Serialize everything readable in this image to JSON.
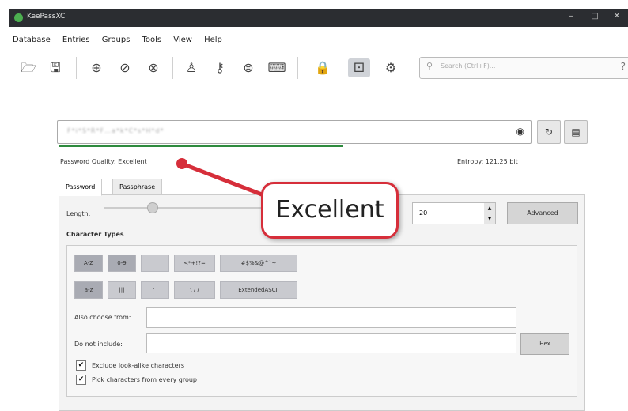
{
  "window": {
    "title": "KeePassXC",
    "controls": {
      "minimize": "–",
      "maximize": "□",
      "close": "✕"
    }
  },
  "menu": [
    "Database",
    "Entries",
    "Groups",
    "Tools",
    "View",
    "Help"
  ],
  "toolbar": {
    "icons": [
      "open-database-icon",
      "save-database-icon",
      "add-entry-icon",
      "edit-entry-icon",
      "delete-entry-icon",
      "copy-username-icon",
      "copy-password-icon",
      "copy-url-icon",
      "autotype-icon",
      "lock-database-icon",
      "password-generator-icon",
      "settings-icon"
    ],
    "search_placeholder": "Search (Ctrl+F)...",
    "search_help": "?"
  },
  "generator": {
    "password_masked": "F*i*S*R*F…a*k*C*s*H*d*",
    "quality_label": "Password Quality: Excellent",
    "entropy": "Entropy: 121.25 bit",
    "tabs": [
      "Password",
      "Passphrase"
    ],
    "length_label": "Length:",
    "length_value": "20",
    "advanced_label": "Advanced",
    "char_types_label": "Character Types",
    "char_row1": [
      "A-Z",
      "0-9",
      "_",
      "<*+!?=",
      "#$%&@^`~"
    ],
    "char_row2": [
      "a-z",
      "|||",
      "\" '",
      "\\ / /",
      "ExtendedASCII"
    ],
    "also_choose_label": "Also choose from:",
    "do_not_include_label": "Do not include:",
    "hex_label": "Hex",
    "exclude_lookalike": "Exclude look-alike characters",
    "pick_every_group": "Pick characters from every group",
    "quality_fill": 0.6
  },
  "callout": {
    "text": "Excellent",
    "color": "#d62e3a"
  },
  "colors": {
    "quality_bar": "#2e8b3e",
    "titlebar": "#2b2d31"
  }
}
